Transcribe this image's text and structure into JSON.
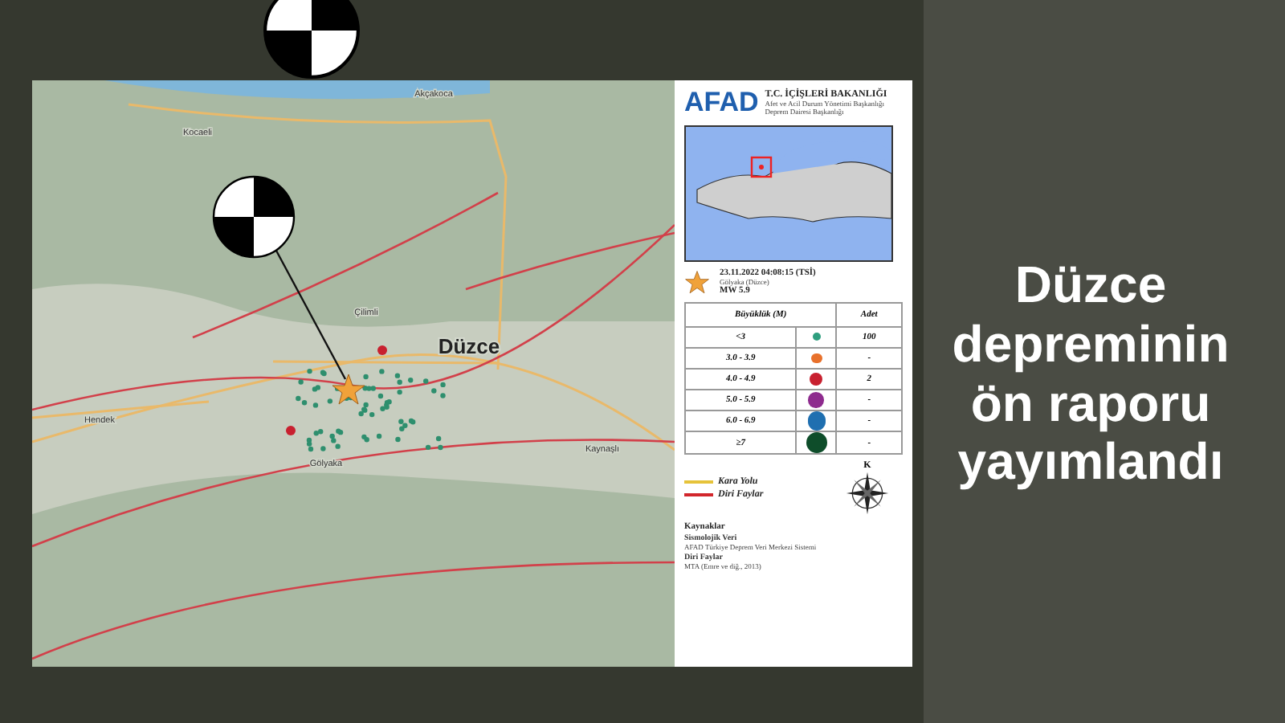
{
  "headline": "Düzce depreminin ön raporu yayımlandı",
  "map": {
    "labels": [
      {
        "text": "Akçakoca",
        "kind": "town"
      },
      {
        "text": "Kocaeli",
        "kind": "town"
      },
      {
        "text": "Çilimli",
        "kind": "town"
      },
      {
        "text": "Düzce",
        "kind": "city"
      },
      {
        "text": "Hendek",
        "kind": "town"
      },
      {
        "text": "Gölyaka",
        "kind": "town"
      },
      {
        "text": "Kaynaşlı",
        "kind": "town"
      }
    ]
  },
  "legend": {
    "logo": "AFAD",
    "ministry": "T.C. İÇİŞLERİ BAKANLIĞI",
    "agency": "Afet ve Acil Durum Yönetimi Başkanlığı",
    "department": "Deprem Dairesi Başkanlığı",
    "event": {
      "datetime": "23.11.2022 04:08:15 (TSİ)",
      "place": "Gölyaka (Düzce)",
      "magnitude": "MW 5.9"
    },
    "table": {
      "columns": [
        "Büyüklük (M)",
        "Adet"
      ],
      "rows": [
        {
          "range": "<3",
          "color": "#2e9e7e",
          "count": "100"
        },
        {
          "range": "3.0 - 3.9",
          "color": "#e8712c",
          "count": "-"
        },
        {
          "range": "4.0 - 4.9",
          "color": "#c8202f",
          "count": "2"
        },
        {
          "range": "5.0 - 5.9",
          "color": "#8e2b8e",
          "count": "-"
        },
        {
          "range": "6.0 - 6.9",
          "color": "#1f6fb0",
          "count": "-"
        },
        {
          "range": "≥7",
          "color": "#0e4d2a",
          "count": "-"
        }
      ]
    },
    "lines": [
      {
        "label": "Kara Yolu",
        "color": "#e6c33a"
      },
      {
        "label": "Diri Faylar",
        "color": "#d2262c"
      }
    ],
    "compass": "K",
    "sources": {
      "title": "Kaynaklar",
      "items": [
        {
          "heading": "Sismolojik Veri",
          "text": "AFAD Türkiye Deprem Veri Merkezi Sistemi"
        },
        {
          "heading": "Diri Faylar",
          "text": "MTA (Emre ve diğ., 2013)"
        }
      ]
    }
  }
}
